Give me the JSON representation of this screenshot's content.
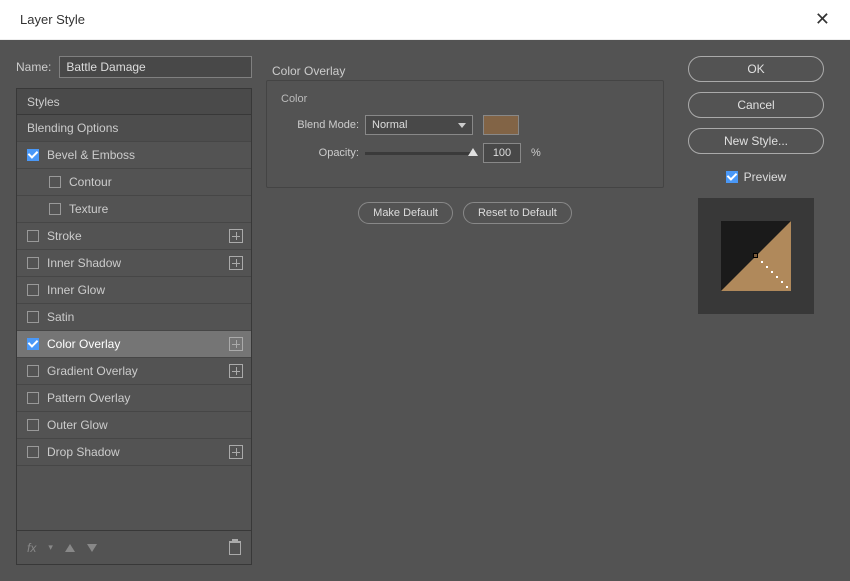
{
  "window": {
    "title": "Layer Style"
  },
  "nameRow": {
    "label": "Name:",
    "value": "Battle Damage"
  },
  "stylesPanel": {
    "header": "Styles",
    "blendingOptions": "Blending Options",
    "items": [
      {
        "label": "Bevel & Emboss",
        "checked": true,
        "plus": false
      },
      {
        "label": "Contour",
        "checked": false,
        "sub": true
      },
      {
        "label": "Texture",
        "checked": false,
        "sub": true
      },
      {
        "label": "Stroke",
        "checked": false,
        "plus": true
      },
      {
        "label": "Inner Shadow",
        "checked": false,
        "plus": true
      },
      {
        "label": "Inner Glow",
        "checked": false
      },
      {
        "label": "Satin",
        "checked": false
      },
      {
        "label": "Color Overlay",
        "checked": true,
        "plus": true,
        "active": true
      },
      {
        "label": "Gradient Overlay",
        "checked": false,
        "plus": true
      },
      {
        "label": "Pattern Overlay",
        "checked": false
      },
      {
        "label": "Outer Glow",
        "checked": false
      },
      {
        "label": "Drop Shadow",
        "checked": false,
        "plus": true
      }
    ],
    "fx": "fx"
  },
  "overlayPanel": {
    "title": "Color Overlay",
    "colorLabel": "Color",
    "blendModeLabel": "Blend Mode:",
    "blendModeValue": "Normal",
    "swatch": "#826446",
    "opacityLabel": "Opacity:",
    "opacityValue": "100",
    "pct": "%",
    "makeDefault": "Make Default",
    "resetDefault": "Reset to Default"
  },
  "rightPanel": {
    "ok": "OK",
    "cancel": "Cancel",
    "newStyle": "New Style...",
    "preview": "Preview"
  }
}
